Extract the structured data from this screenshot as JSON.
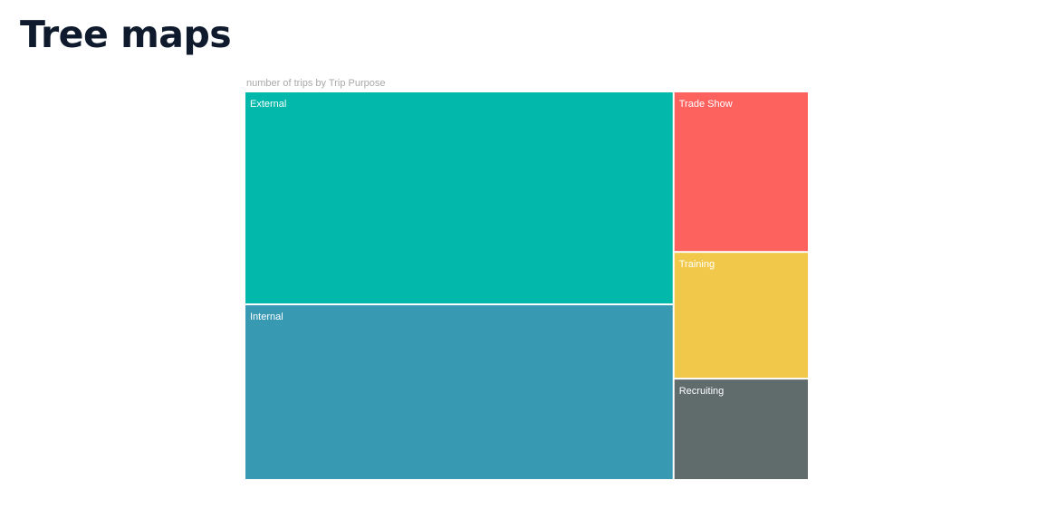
{
  "page": {
    "title": "Tree maps"
  },
  "chart_data": {
    "type": "treemap",
    "title": "number of trips by Trip Purpose",
    "legend": "none",
    "items": [
      {
        "label": "External",
        "value": 40,
        "color": "#01b8aa"
      },
      {
        "label": "Internal",
        "value": 33,
        "color": "#3899b3"
      },
      {
        "label": "Trade Show",
        "value": 9.5,
        "color": "#fd625e"
      },
      {
        "label": "Training",
        "value": 7.5,
        "color": "#f2c84b"
      },
      {
        "label": "Recruiting",
        "value": 6,
        "color": "#606b6b"
      }
    ]
  }
}
